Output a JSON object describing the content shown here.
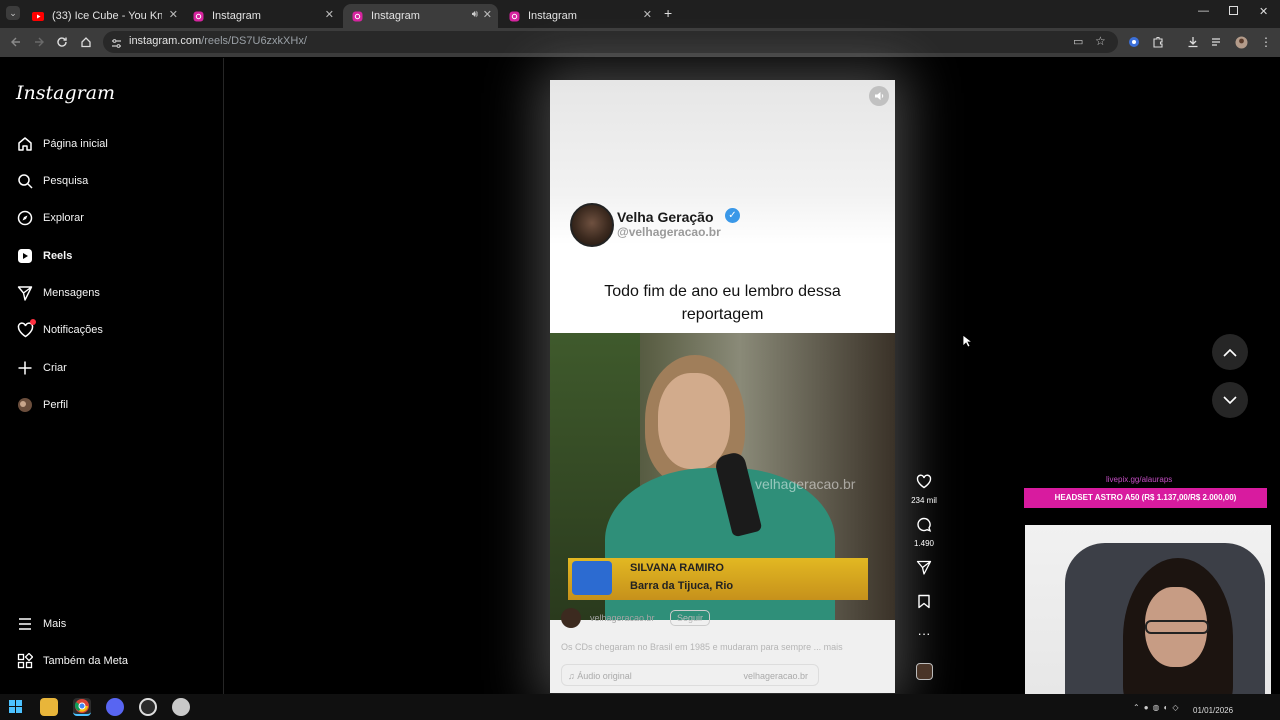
{
  "browser": {
    "tabs": [
      {
        "title": "(33) Ice Cube - You Know How I Like It",
        "favicon": "youtube-icon"
      },
      {
        "title": "Instagram",
        "favicon": "instagram-icon"
      },
      {
        "title": "Instagram",
        "favicon": "instagram-icon",
        "active": true,
        "audio": true
      },
      {
        "title": "Instagram",
        "favicon": "instagram-icon"
      }
    ],
    "url_host": "instagram.com",
    "url_path": "/reels/DS7U6zxkXHx/"
  },
  "sidebar": {
    "logo": "Instagram",
    "items": [
      {
        "label": "Página inicial",
        "icon": "home-icon"
      },
      {
        "label": "Pesquisa",
        "icon": "search-icon"
      },
      {
        "label": "Explorar",
        "icon": "compass-icon"
      },
      {
        "label": "Reels",
        "icon": "reels-icon"
      },
      {
        "label": "Mensagens",
        "icon": "send-icon"
      },
      {
        "label": "Notificações",
        "icon": "heart-icon"
      },
      {
        "label": "Criar",
        "icon": "plus-icon"
      },
      {
        "label": "Perfil",
        "icon": "avatar"
      }
    ],
    "more": "Mais",
    "meta": "Também da Meta"
  },
  "reel": {
    "channel_name": "Velha Geração",
    "channel_handle": "@velhageracao.br",
    "caption_overlay": "Todo fim de ano eu lembro dessa reportagem",
    "video_watermark": "velhageracao.br",
    "lower_third_name": "SILVANA RAMIRO",
    "lower_third_place": "Barra da Tijuca, Rio",
    "username": "velhageracao.br",
    "follow": "Seguir",
    "description": "Os CDs chegaram no Brasil em 1985 e mudaram para sempre ...",
    "more": "mais",
    "audio_label": "Áudio original",
    "audio_user": "velhageracao.br"
  },
  "actions": {
    "likes": "234 mil",
    "comments": "1.490"
  },
  "stream_overlay": {
    "link": "livepix.gg/alauraps",
    "banner": "HEADSET ASTRO A50 (R$ 1.137,00/R$ 2.000,00)"
  },
  "taskbar": {
    "date": "01/01/2026"
  },
  "colors": {
    "instagram_bg": "#000000",
    "verified": "#3a98e8",
    "banner": "#d81b9f"
  }
}
